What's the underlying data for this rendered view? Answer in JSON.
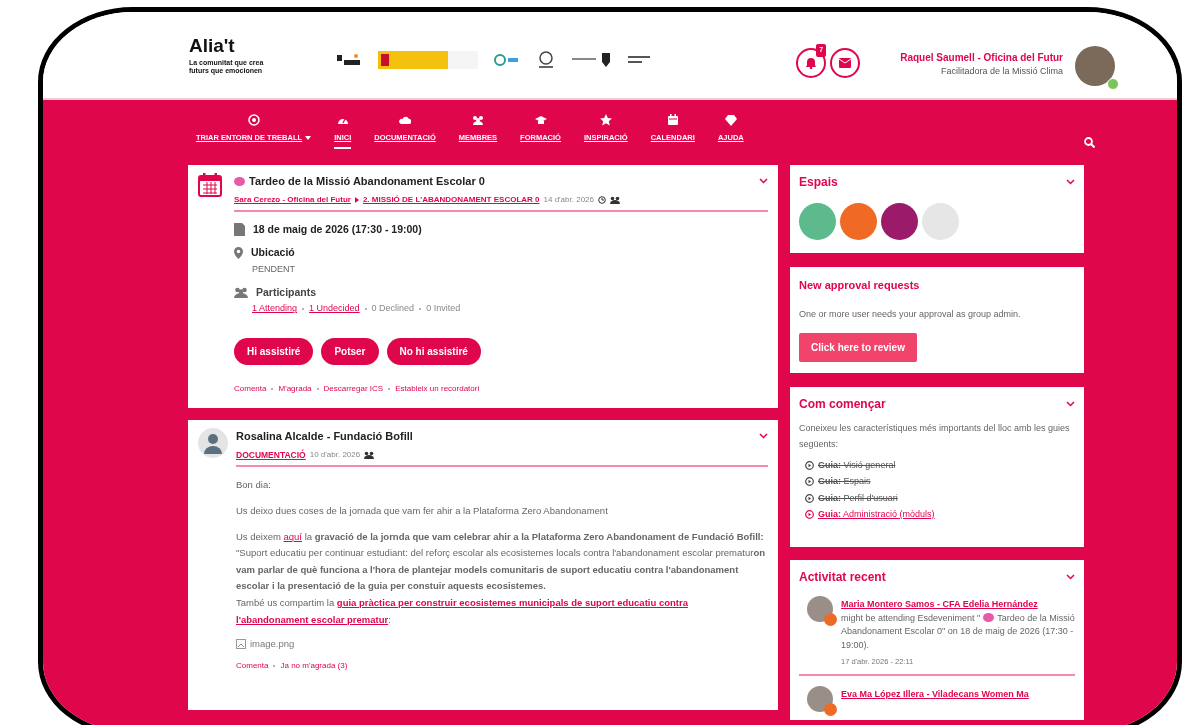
{
  "header": {
    "logo": "Alia't",
    "tagline": "La comunitat que crea futurs que emocionen",
    "notifications": {
      "count": "7"
    },
    "user": {
      "name": "Raquel Saumell - Oficina del Futur",
      "role": "Facilitadora de la Missió Clima",
      "online": true
    }
  },
  "nav": [
    {
      "label": "TRIAR ENTORN DE TREBALL",
      "dropdown": true,
      "selected": false
    },
    {
      "label": "INICI",
      "dropdown": false,
      "selected": true
    },
    {
      "label": "DOCUMENTACIÓ",
      "dropdown": false,
      "selected": false
    },
    {
      "label": "MEMBRES",
      "dropdown": false,
      "selected": false
    },
    {
      "label": "FORMACIÓ",
      "dropdown": false,
      "selected": false
    },
    {
      "label": "INSPIRACIÓ",
      "dropdown": false,
      "selected": false
    },
    {
      "label": "CALENDARI",
      "dropdown": false,
      "selected": false
    },
    {
      "label": "AJUDA",
      "dropdown": false,
      "selected": false
    }
  ],
  "event": {
    "title": "Tardeo de la Missió Abandonament Escolar 0",
    "author": "Sara Cerezo - Oficina del Futur",
    "group": "2. MISSIÓ DE L'ABANDONAMENT ESCOLAR 0",
    "date": "14 d'abr. 2026",
    "when": "18 de maig de 2026 (17:30 - 19:00)",
    "location_label": "Ubicació",
    "location": "PENDENT",
    "participants_label": "Participants",
    "counts": [
      {
        "text": "1 Attending",
        "link": true
      },
      {
        "text": "1 Undecided",
        "link": true
      },
      {
        "text": "0 Declined",
        "link": false
      },
      {
        "text": "0 Invited",
        "link": false
      }
    ],
    "buttons": [
      "Hi assistiré",
      "Potser",
      "No hi assistiré"
    ],
    "actions": [
      "Comenta",
      "M'agrada",
      "Descarregar ICS",
      "Estableix un recordatori"
    ]
  },
  "post": {
    "author": "Rosalina Alcalde - Fundació Bofill",
    "group": "DOCUMENTACIÓ",
    "date": "10 d'abr. 2026",
    "paragraphs": [
      [
        {
          "kind": "text",
          "text": "Bon dia:"
        }
      ],
      [
        {
          "kind": "text",
          "text": "Us deixo dues coses de la jornada que vam fer ahir a la Plataforma Zero Abandonament"
        }
      ],
      [
        {
          "kind": "text",
          "text": "Us deixem "
        },
        {
          "kind": "link",
          "text": "aquí"
        },
        {
          "kind": "text",
          "text": " la **gravació de la jornda que vam celebrar ahir a la Plataforma Zero Abandonament de Fundació Bofill:** \"Suport educatiu per continuar estudiant: del reforç escolar als ecosistemes locals contra l'abandonament escolar prematur**on vam parlar de què funciona a l'hora de plantejar models comunitaris de suport educatiu contra l'abandonament escolar i la presentació de la guia per constuir aquests ecosistemes.**"
        },
        {
          "kind": "break"
        },
        {
          "kind": "text",
          "text": "També us compartim la "
        },
        {
          "kind": "boldlink",
          "text": "guia pràctica per construir ecosistemes municipals de suport educatiu contra"
        },
        {
          "kind": "break"
        },
        {
          "kind": "boldlink",
          "text": "l'abandonament escolar prematur"
        },
        {
          "kind": "text",
          "text": ":"
        }
      ]
    ],
    "image_alt": "image.png",
    "actions": [
      "Comenta",
      "Ja no m'agrada (3)"
    ]
  },
  "spaces": {
    "title": "Espais",
    "items": [
      {
        "color": "#5dba8c"
      },
      {
        "color": "#ef6a24"
      },
      {
        "color": "#9b1b6a"
      },
      {
        "color": "#e6e6e6"
      }
    ]
  },
  "approval": {
    "title": "New approval requests",
    "text": "One or more user needs your approval as group admin.",
    "button": "Click here to review"
  },
  "start": {
    "title": "Com començar",
    "intro": "Coneixeu les característiques més importants del lloc amb les guies següents:",
    "guides": [
      {
        "prefix": "Guia:",
        "text": "Visió general",
        "done": true
      },
      {
        "prefix": "Guia:",
        "text": "Espais",
        "done": true
      },
      {
        "prefix": "Guia:",
        "text": "Perfil d'usuari",
        "done": true
      },
      {
        "prefix": "Guia:",
        "text": "Administració (mòduls)",
        "done": false
      }
    ]
  },
  "activity": {
    "title": "Activitat recent",
    "items": [
      {
        "name": "Maria Montero Samos - CFA Edelia Hernández",
        "before": "might be attending Esdeveniment \"",
        "after": "Tardeo de la Missió Abandonament Escolar 0\" on 18 de maig de 2026 (17:30 - 19:00).",
        "time": "17 d'abr. 2026 - 22:11"
      },
      {
        "name": "Eva Ma López Illera - Viladecans Women Ma"
      }
    ]
  }
}
